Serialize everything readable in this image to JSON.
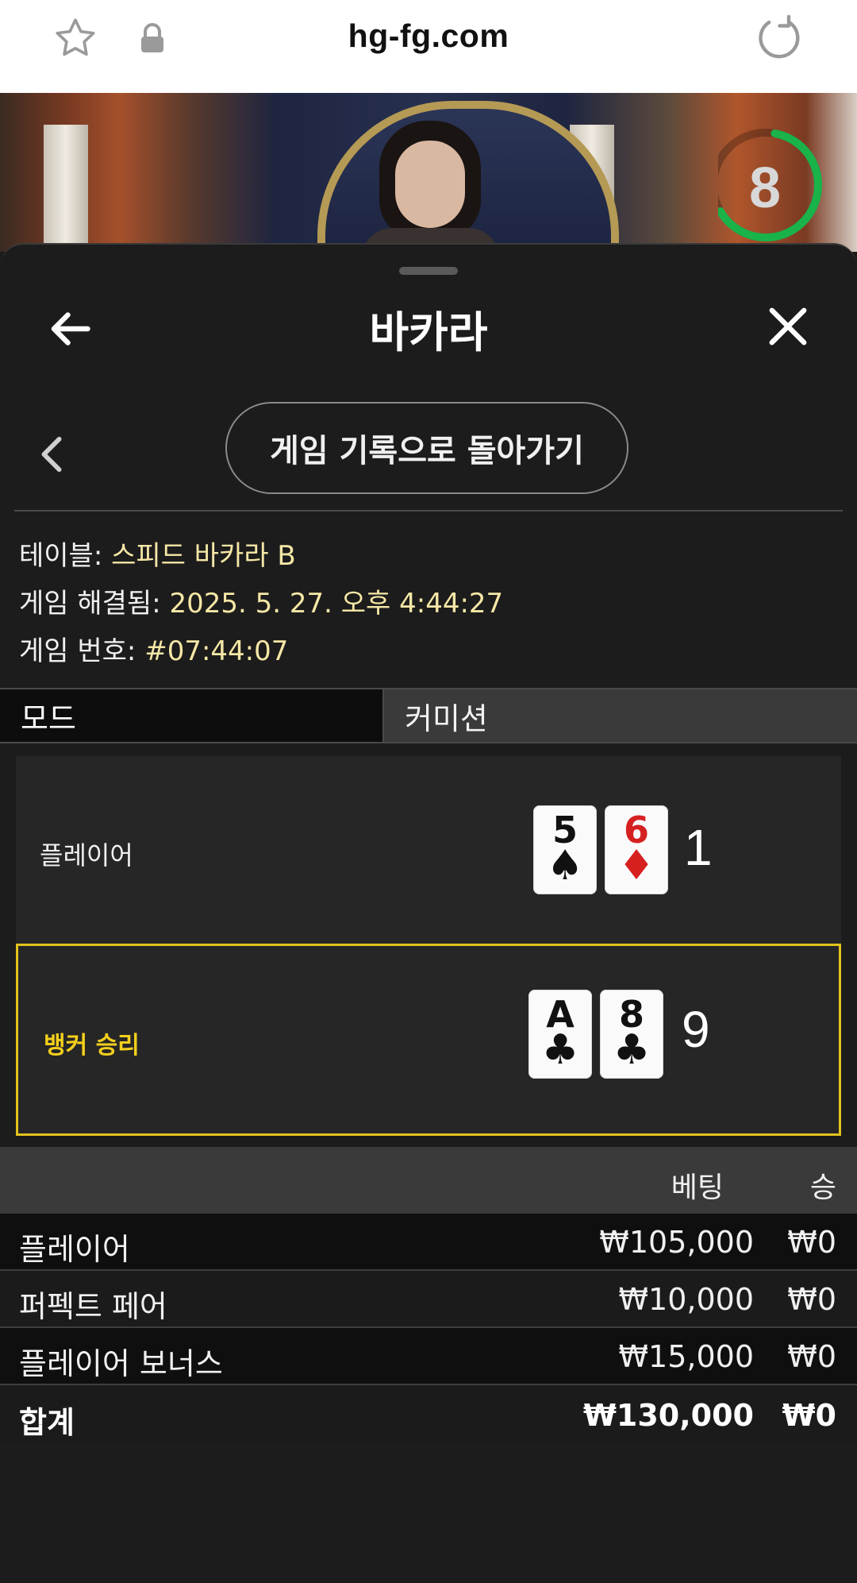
{
  "browser": {
    "url": "hg-fg.com",
    "icons": [
      "star-icon",
      "lock-icon",
      "reload-icon"
    ]
  },
  "video": {
    "countdown": "8",
    "countdown_color": "#19b34a"
  },
  "sheet": {
    "title": "바카라",
    "back_to_history": "게임 기록으로 돌아가기",
    "info": {
      "table_label": "테이블: ",
      "table_value": "스피드 바카라 B",
      "resolved_label": "게임 해결됨: ",
      "resolved_value": "2025. 5. 27. 오후 4:44:27",
      "number_label": "게임 번호: ",
      "number_value": "#07:44:07"
    },
    "tabs": {
      "mode": "모드",
      "commission": "커미션"
    }
  },
  "hands": {
    "player": {
      "label": "플레이어",
      "score": "1",
      "cards": [
        {
          "rank": "5",
          "suit": "♠",
          "color": "black"
        },
        {
          "rank": "6",
          "suit": "♦",
          "color": "red"
        }
      ]
    },
    "banker": {
      "label": "뱅커 승리",
      "score": "9",
      "cards": [
        {
          "rank": "A",
          "suit": "♣",
          "color": "black"
        },
        {
          "rank": "8",
          "suit": "♣",
          "color": "black"
        }
      ]
    },
    "highlight_color": "#e3c21d"
  },
  "bets": {
    "headers": {
      "bet": "베팅",
      "win": "승"
    },
    "rows": [
      {
        "name": "플레이어",
        "bet": "₩105,000",
        "win": "₩0"
      },
      {
        "name": "퍼펙트 페어",
        "bet": "₩10,000",
        "win": "₩0"
      },
      {
        "name": "플레이어 보너스",
        "bet": "₩15,000",
        "win": "₩0"
      }
    ],
    "total": {
      "name": "합계",
      "bet": "₩130,000",
      "win": "₩0"
    }
  }
}
